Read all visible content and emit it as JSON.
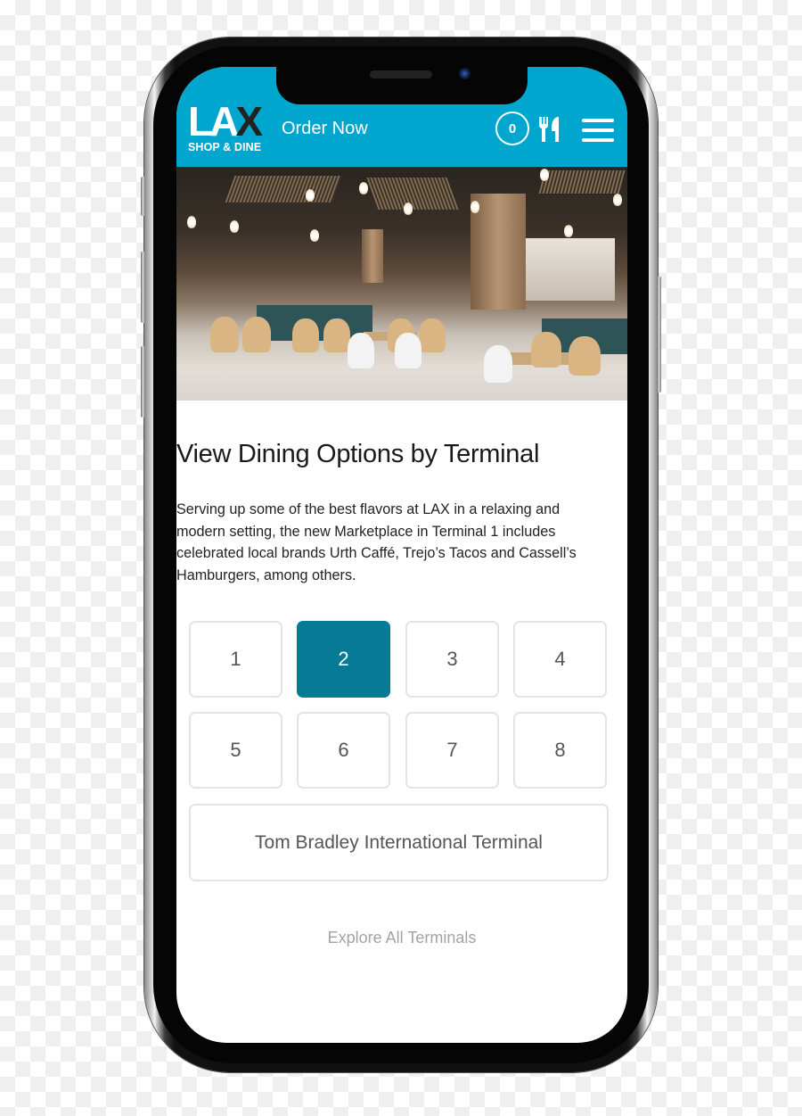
{
  "app": {
    "logo_main": "LA",
    "logo_accent": "X",
    "logo_sub": "SHOP & DINE"
  },
  "header": {
    "order_now_label": "Order Now",
    "cart_count": "0",
    "icons": {
      "utensils": "fork-knife-icon",
      "menu": "hamburger-menu-icon"
    },
    "colors": {
      "header_bg": "#00A6CE",
      "active_terminal": "#077B96"
    }
  },
  "hero": {
    "alt": "Terminal 1 Marketplace dining area"
  },
  "main": {
    "title": "View Dining Options by Terminal",
    "intro": "Serving up some of the best flavors at LAX in a relaxing and modern setting, the new Marketplace in Terminal 1 includes celebrated local brands Urth Caffé, Trejo’s Tacos and Cassell’s Hamburgers, among others.",
    "terminals": [
      {
        "label": "1",
        "active": false
      },
      {
        "label": "2",
        "active": true
      },
      {
        "label": "3",
        "active": false
      },
      {
        "label": "4",
        "active": false
      },
      {
        "label": "5",
        "active": false
      },
      {
        "label": "6",
        "active": false
      },
      {
        "label": "7",
        "active": false
      },
      {
        "label": "8",
        "active": false
      }
    ],
    "international_label": "Tom Bradley International Terminal",
    "explore_label": "Explore All Terminals"
  }
}
